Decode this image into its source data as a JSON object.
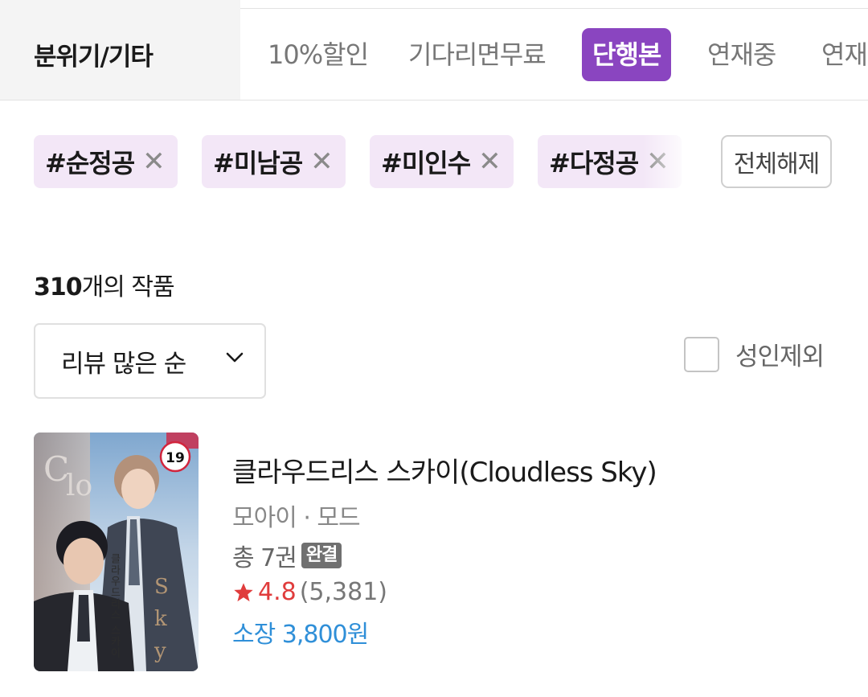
{
  "category_label": "분위기/기타",
  "tabs": [
    {
      "label": "10%할인",
      "active": false
    },
    {
      "label": "기다리면무료",
      "active": false
    },
    {
      "label": "단행본",
      "active": true
    },
    {
      "label": "연재중",
      "active": false
    },
    {
      "label": "연재",
      "active": false
    }
  ],
  "tag_chips": [
    {
      "label": "#순정공"
    },
    {
      "label": "#미남공"
    },
    {
      "label": "#미인수"
    },
    {
      "label": "#다정공"
    }
  ],
  "clear_all_label": "전체해제",
  "result_count": "310",
  "result_suffix": "개의 작품",
  "sort": {
    "selected": "리뷰 많은 순"
  },
  "adult_filter": {
    "label": "성인제외",
    "checked": false
  },
  "books": [
    {
      "title": "클라우드리스 스카이(Cloudless Sky)",
      "authors": "모아이 · 모드",
      "volumes": "총 7권",
      "status_badge": "완결",
      "rating": "4.8",
      "review_count": "(5,381)",
      "price": "소장 3,800원",
      "age_badge": "19"
    }
  ],
  "colors": {
    "accent": "#8a45c0",
    "chip_bg": "#f3e7f7",
    "price": "#2f8fd8",
    "rating": "#e03c3c"
  }
}
